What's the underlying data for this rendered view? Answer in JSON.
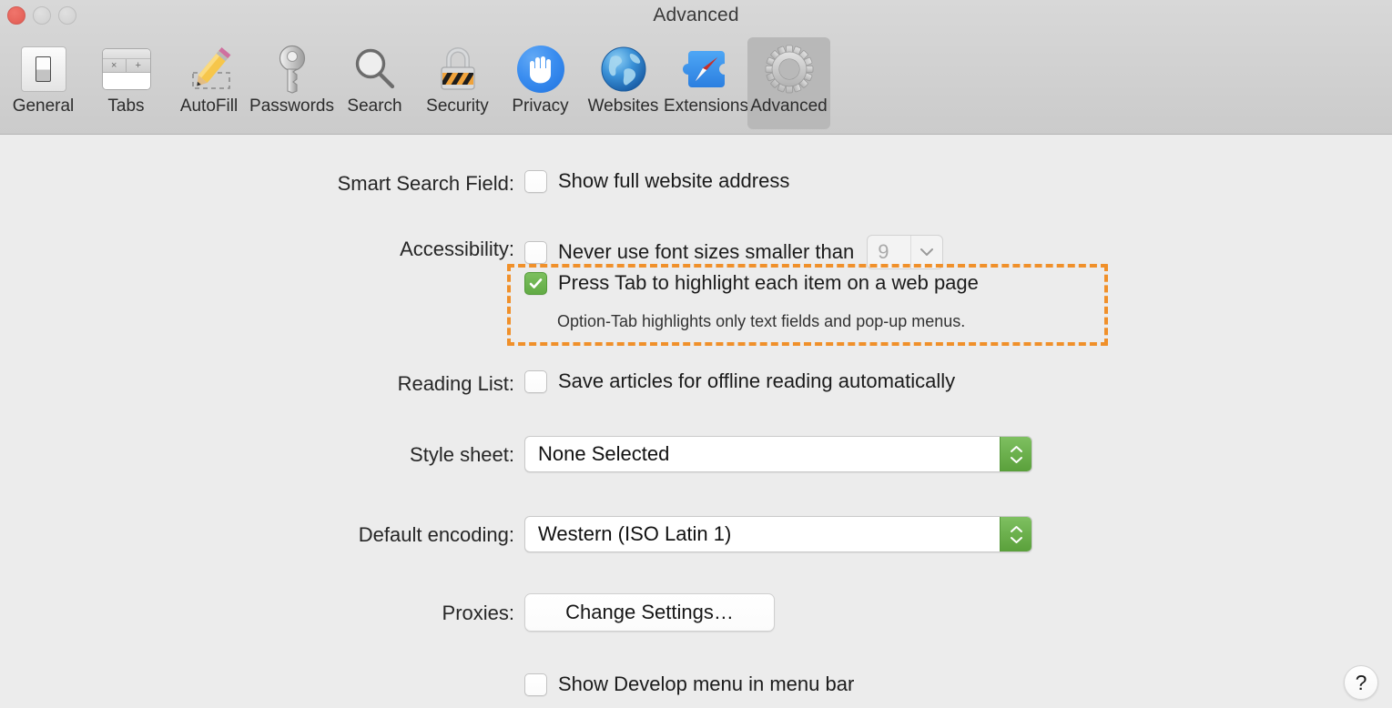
{
  "window": {
    "title": "Advanced",
    "traffic_lights": {
      "close": "close-button",
      "minimize": "minimize-button",
      "maximize": "maximize-button"
    }
  },
  "toolbar": {
    "items": [
      {
        "label": "General",
        "icon": "general-icon",
        "selected": false
      },
      {
        "label": "Tabs",
        "icon": "tabs-icon",
        "selected": false
      },
      {
        "label": "AutoFill",
        "icon": "autofill-icon",
        "selected": false
      },
      {
        "label": "Passwords",
        "icon": "key-icon",
        "selected": false
      },
      {
        "label": "Search",
        "icon": "magnifier-icon",
        "selected": false
      },
      {
        "label": "Security",
        "icon": "lock-icon",
        "selected": false
      },
      {
        "label": "Privacy",
        "icon": "hand-icon",
        "selected": false
      },
      {
        "label": "Websites",
        "icon": "globe-icon",
        "selected": false
      },
      {
        "label": "Extensions",
        "icon": "puzzle-icon",
        "selected": false
      },
      {
        "label": "Advanced",
        "icon": "gear-icon",
        "selected": true
      }
    ],
    "tabs_icon_glyphs": {
      "close": "×",
      "add": "+"
    }
  },
  "settings": {
    "smart_search_field": {
      "label": "Smart Search Field:",
      "checkbox_label": "Show full website address",
      "checked": false
    },
    "accessibility": {
      "label": "Accessibility:",
      "font_size_checkbox_label": "Never use font sizes smaller than",
      "font_size_checked": false,
      "font_size_value": "9",
      "tab_highlight_checkbox_label": "Press Tab to highlight each item on a web page",
      "tab_highlight_checked": true,
      "tab_highlight_caption": "Option-Tab highlights only text fields and pop-up menus."
    },
    "reading_list": {
      "label": "Reading List:",
      "checkbox_label": "Save articles for offline reading automatically",
      "checked": false
    },
    "style_sheet": {
      "label": "Style sheet:",
      "value": "None Selected"
    },
    "default_encoding": {
      "label": "Default encoding:",
      "value": "Western (ISO Latin 1)"
    },
    "proxies": {
      "label": "Proxies:",
      "button_label": "Change Settings…"
    },
    "develop_menu": {
      "checkbox_label": "Show Develop menu in menu bar",
      "checked": false
    }
  },
  "help": {
    "glyph": "?"
  },
  "colors": {
    "highlight_outline": "#f0902a",
    "checkbox_checked": "#62ab45",
    "stepper_green": "#6cb04d",
    "toolbar_selected": "#b8b8b8",
    "content_bg": "#ececec",
    "traffic_close": "#e8675e"
  }
}
